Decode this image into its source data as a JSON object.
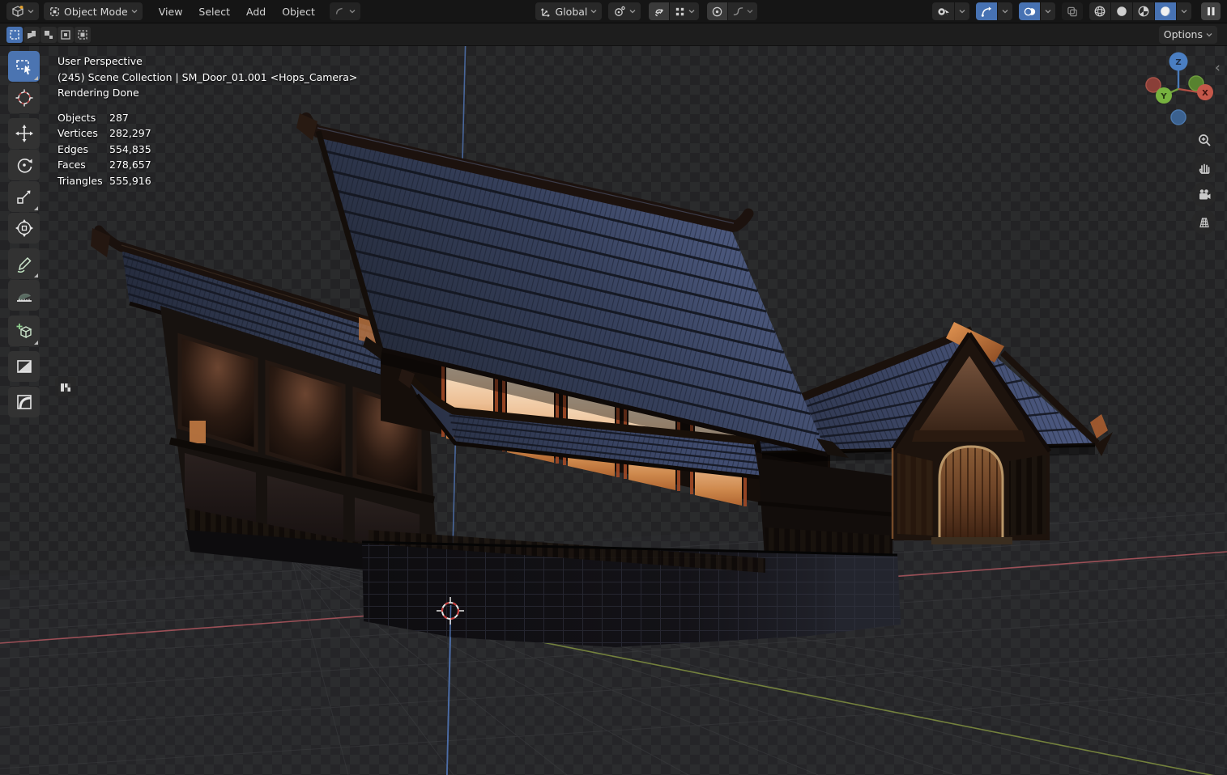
{
  "topbar": {
    "editor": {
      "icon": "editor-type-icon"
    },
    "mode": {
      "icon": "object-mode-icon",
      "label": "Object Mode"
    },
    "menus": [
      "View",
      "Select",
      "Add",
      "Object"
    ],
    "last_tool": {
      "icon": "active-tool-icon"
    },
    "orientation": {
      "icon": "transform-orientation-icon",
      "label": "Global"
    },
    "pivot": {
      "icon": "pivot-point-icon"
    },
    "snap": {
      "magnet_icon": "snap-magnet-icon",
      "target_icon": "snap-target-icon"
    },
    "proportional": {
      "icon": "proportional-editing-icon",
      "falloff_icon": "falloff-curve-icon"
    },
    "visibility": {
      "icon": "object-visibility-icon"
    },
    "gizmos": {
      "icon": "gizmos-icon",
      "active": true
    },
    "overlays": {
      "icon": "overlays-icon",
      "active": true
    },
    "xray": {
      "icon": "xray-toggle-icon",
      "active": false
    },
    "shading": {
      "modes": [
        "wireframe",
        "solid",
        "material-preview",
        "rendered"
      ],
      "active": "rendered"
    },
    "pause": {
      "icon": "pause-icon"
    }
  },
  "toolsettings": {
    "select_modes": [
      "set",
      "extend",
      "subtract",
      "invert",
      "intersect"
    ],
    "active_select_mode": "set",
    "options_label": "Options"
  },
  "toolbar": {
    "tools": [
      "select-box",
      "cursor",
      "move",
      "rotate",
      "scale",
      "transform",
      "annotate",
      "measure",
      "add-cube",
      "boxcutter",
      "fillet"
    ],
    "active_tool": "select-box"
  },
  "viewport": {
    "overlay": {
      "view_label": "User Perspective",
      "context_label": "(245) Scene Collection | SM_Door_01.001 <Hops_Camera>",
      "status_label": "Rendering Done",
      "stats": [
        {
          "label": "Objects",
          "value": "287"
        },
        {
          "label": "Vertices",
          "value": "282,297"
        },
        {
          "label": "Edges",
          "value": "554,835"
        },
        {
          "label": "Faces",
          "value": "278,657"
        },
        {
          "label": "Triangles",
          "value": "555,916"
        }
      ]
    },
    "nav_gizmo": {
      "axes": {
        "x": "X",
        "y": "Y",
        "z": "Z"
      }
    },
    "side_buttons": [
      "zoom",
      "pan",
      "camera-view",
      "toggle-ortho"
    ],
    "scene_description": "Night render: Japanese-style timber building, blue tiled roofs, glowing orange windows, arched wooden door, stone base, on transparent checker background"
  },
  "colors": {
    "active_accent": "#4772b3",
    "axis_x": "#a8545c",
    "axis_y": "#7d8c3f",
    "axis_z": "#4d6ea8",
    "gizmo_x": "#c4584a",
    "gizmo_y": "#77b13f",
    "gizmo_z": "#4a7ec2",
    "window_glow": "#edbf94",
    "door_wood": "#6b4226",
    "roof_tile": "#3c4763"
  }
}
